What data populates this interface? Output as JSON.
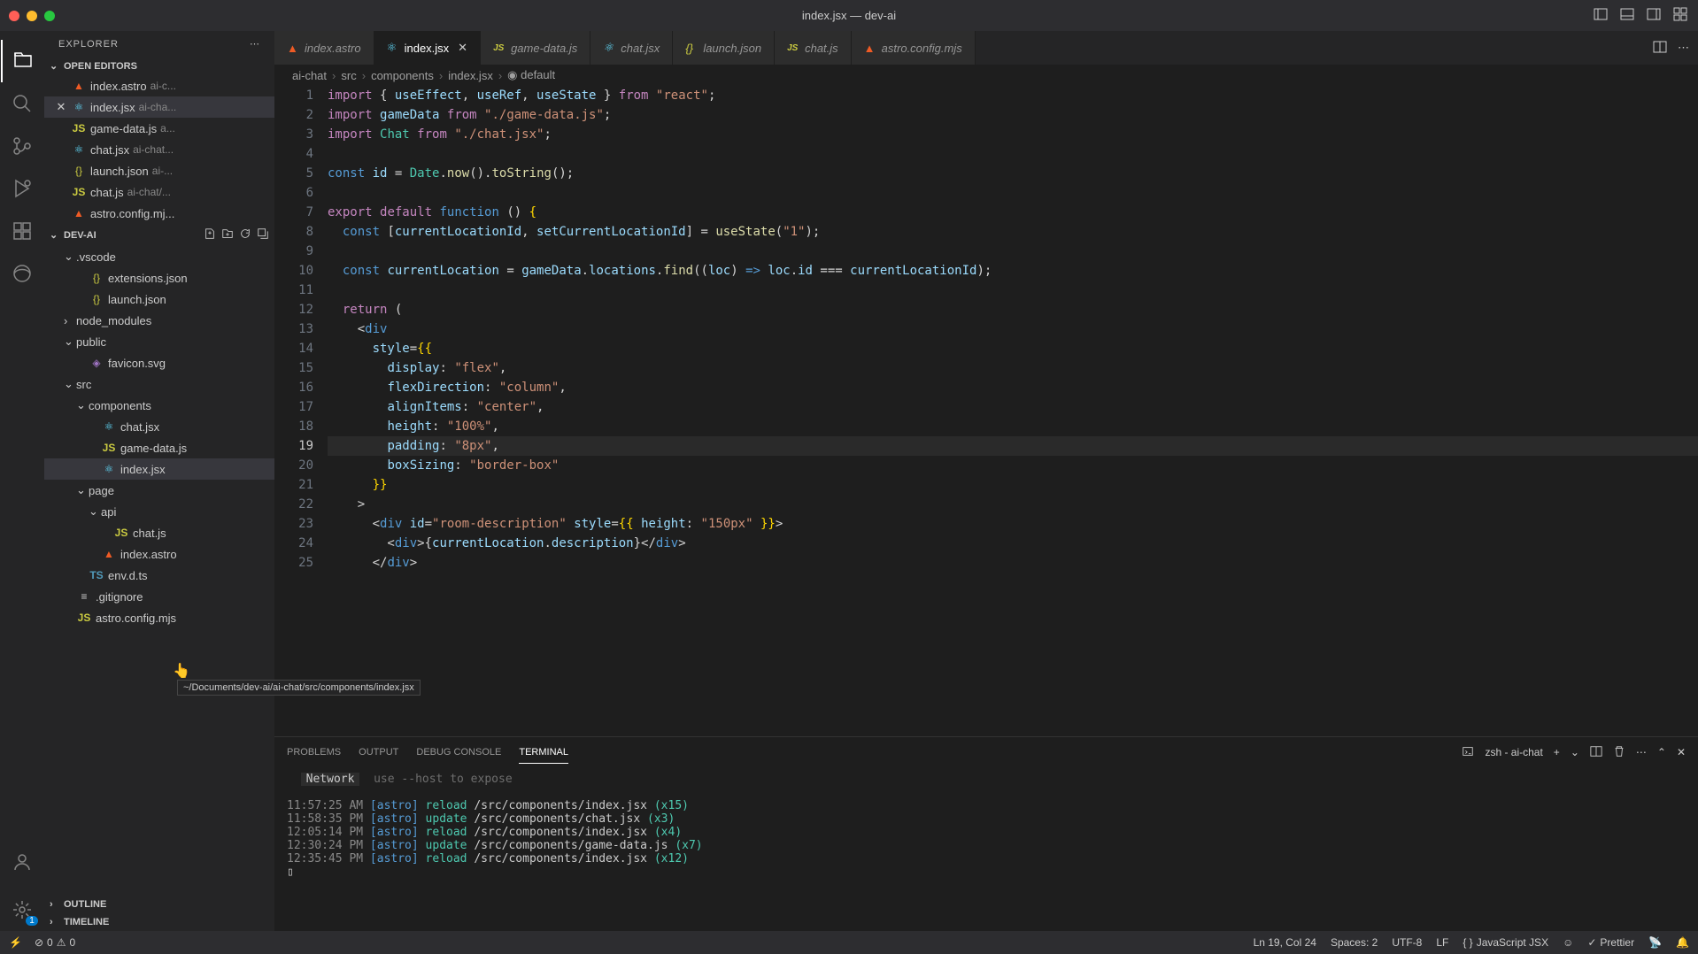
{
  "titlebar": {
    "title": "index.jsx — dev-ai"
  },
  "sidebar": {
    "title": "EXPLORER",
    "openEditors": {
      "label": "OPEN EDITORS",
      "items": [
        {
          "icon": "astro",
          "name": "index.astro",
          "desc": "ai-c..."
        },
        {
          "icon": "react",
          "name": "index.jsx",
          "desc": "ai-cha...",
          "active": true
        },
        {
          "icon": "js",
          "name": "game-data.js",
          "desc": "a..."
        },
        {
          "icon": "react",
          "name": "chat.jsx",
          "desc": "ai-chat..."
        },
        {
          "icon": "json",
          "name": "launch.json",
          "desc": "ai-..."
        },
        {
          "icon": "js",
          "name": "chat.js",
          "desc": "ai-chat/..."
        },
        {
          "icon": "astro",
          "name": "astro.config.mj...",
          "desc": ""
        }
      ]
    },
    "project": {
      "label": "DEV-AI"
    },
    "fileTree": [
      {
        "type": "folder",
        "name": ".vscode",
        "indent": 1,
        "open": true
      },
      {
        "type": "file",
        "icon": "json",
        "name": "extensions.json",
        "indent": 2
      },
      {
        "type": "file",
        "icon": "json",
        "name": "launch.json",
        "indent": 2
      },
      {
        "type": "folder",
        "name": "node_modules",
        "indent": 1,
        "open": false
      },
      {
        "type": "folder",
        "name": "public",
        "indent": 1,
        "open": true
      },
      {
        "type": "file",
        "icon": "svg",
        "name": "favicon.svg",
        "indent": 2
      },
      {
        "type": "folder",
        "name": "src",
        "indent": 1,
        "open": true
      },
      {
        "type": "folder",
        "name": "components",
        "indent": 2,
        "open": true
      },
      {
        "type": "file",
        "icon": "react",
        "name": "chat.jsx",
        "indent": 3
      },
      {
        "type": "file",
        "icon": "js",
        "name": "game-data.js",
        "indent": 3
      },
      {
        "type": "file",
        "icon": "react",
        "name": "index.jsx",
        "indent": 3,
        "selected": true
      },
      {
        "type": "folder",
        "name": "page",
        "indent": 2,
        "open": true
      },
      {
        "type": "folder",
        "name": "api",
        "indent": 3,
        "open": true
      },
      {
        "type": "file",
        "icon": "js",
        "name": "chat.js",
        "indent": 4
      },
      {
        "type": "file",
        "icon": "astro",
        "name": "index.astro",
        "indent": 3
      },
      {
        "type": "file",
        "icon": "ts",
        "name": "env.d.ts",
        "indent": 2
      },
      {
        "type": "file",
        "icon": "text",
        "name": ".gitignore",
        "indent": 1
      },
      {
        "type": "file",
        "icon": "js",
        "name": "astro.config.mjs",
        "indent": 1
      }
    ],
    "outline": "OUTLINE",
    "timeline": "TIMELINE"
  },
  "tabs": [
    {
      "icon": "astro",
      "name": "index.astro"
    },
    {
      "icon": "react",
      "name": "index.jsx",
      "active": true
    },
    {
      "icon": "js",
      "name": "game-data.js"
    },
    {
      "icon": "react",
      "name": "chat.jsx"
    },
    {
      "icon": "json",
      "name": "launch.json"
    },
    {
      "icon": "js",
      "name": "chat.js"
    },
    {
      "icon": "astro",
      "name": "astro.config.mjs"
    }
  ],
  "breadcrumbs": [
    "ai-chat",
    "src",
    "components",
    "index.jsx",
    "default"
  ],
  "code": {
    "lines": [
      1,
      2,
      3,
      4,
      5,
      6,
      7,
      8,
      9,
      10,
      11,
      12,
      13,
      14,
      15,
      16,
      17,
      18,
      19,
      20,
      21,
      22,
      23,
      24,
      25
    ]
  },
  "panel": {
    "tabs": [
      "PROBLEMS",
      "OUTPUT",
      "DEBUG CONSOLE",
      "TERMINAL"
    ],
    "activeTab": "TERMINAL",
    "shellLabel": "zsh - ai-chat",
    "network": "Network",
    "networkHint": "use --host to expose",
    "lines": [
      {
        "time": "11:57:25 AM",
        "tag": "[astro]",
        "action": "reload",
        "path": "/src/components/index.jsx",
        "count": "(x15)"
      },
      {
        "time": "11:58:35 PM",
        "tag": "[astro]",
        "action": "update",
        "path": "/src/components/chat.jsx",
        "count": "(x3)"
      },
      {
        "time": "12:05:14 PM",
        "tag": "[astro]",
        "action": "reload",
        "path": "/src/components/index.jsx",
        "count": "(x4)"
      },
      {
        "time": "12:30:24 PM",
        "tag": "[astro]",
        "action": "update",
        "path": "/src/components/game-data.js",
        "count": "(x7)"
      },
      {
        "time": "12:35:45 PM",
        "tag": "[astro]",
        "action": "reload",
        "path": "/src/components/index.jsx",
        "count": "(x12)"
      }
    ]
  },
  "statusbar": {
    "errors": "0",
    "warnings": "0",
    "position": "Ln 19, Col 24",
    "spaces": "Spaces: 2",
    "encoding": "UTF-8",
    "eol": "LF",
    "lang": "JavaScript JSX",
    "prettier": "Prettier"
  },
  "tooltip": "~/Documents/dev-ai/ai-chat/src/components/index.jsx",
  "settings_badge": "1"
}
